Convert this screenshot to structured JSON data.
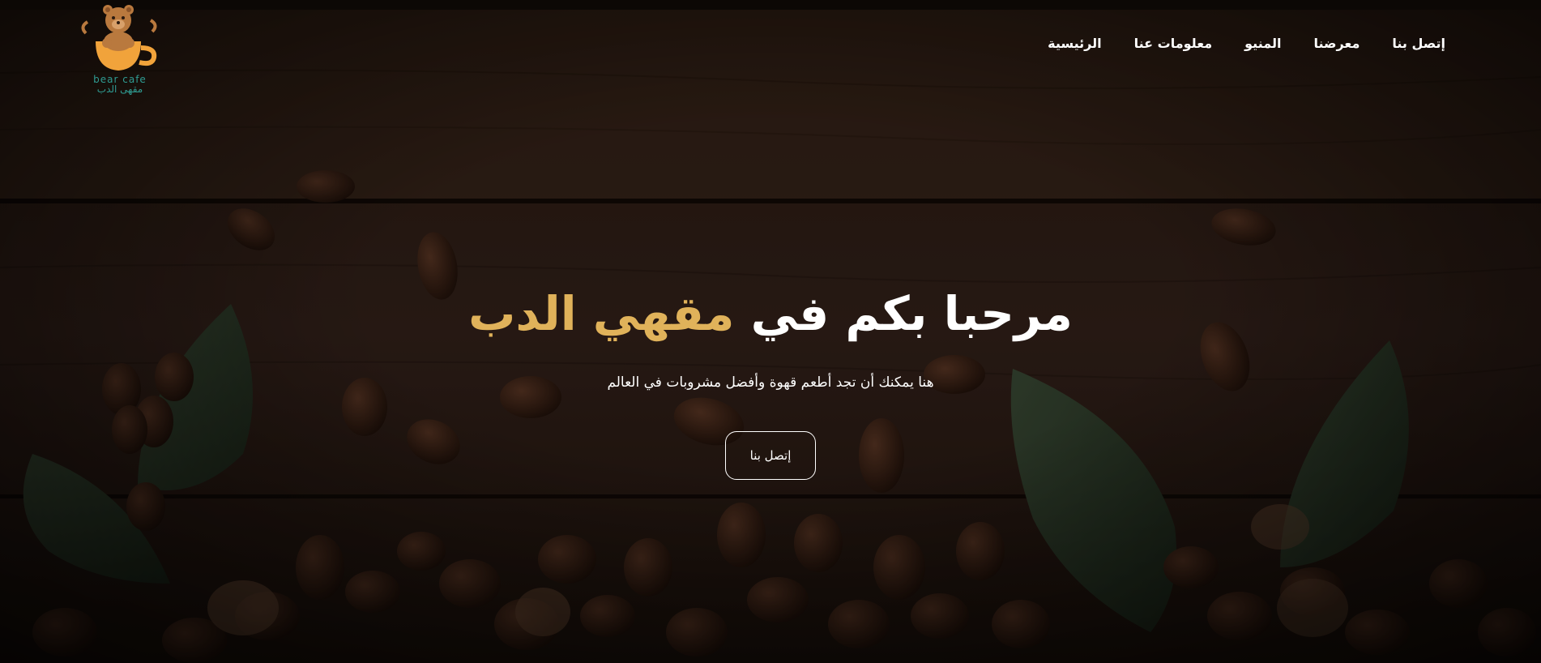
{
  "brand": {
    "logo_en": "bear cafe",
    "logo_ar": "مقهى الدب",
    "logo_icon": "bear-cup-icon"
  },
  "nav": {
    "items": [
      "إتصل بنا",
      "معرضنا",
      "المنيو",
      "معلومات عنا",
      "الرئيسية"
    ]
  },
  "hero": {
    "title_start": "مرحبا بكم في ",
    "title_accent": "مقهي الدب",
    "subtitle": "هنا يمكنك أن تجد أطعم قهوة وأفضل مشروبات في العالم",
    "cta_label": "إتصل بنا"
  },
  "colors": {
    "accent": "#e0b25a",
    "text": "#ffffff",
    "logo_teal": "#2f9c93",
    "wood_dark": "#1c110a"
  }
}
